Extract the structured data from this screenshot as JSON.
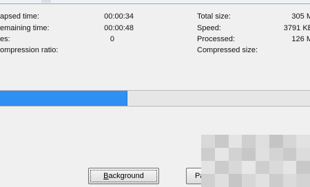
{
  "left": {
    "elapsed_label": "apsed time:",
    "elapsed_value": "00:00:34",
    "remaining_label": "emaining time:",
    "remaining_value": "00:00:48",
    "files_label": "es:",
    "files_value": "0",
    "ratio_label": "ompression ratio:",
    "ratio_value": ""
  },
  "right": {
    "total_label": "Total size:",
    "total_value": "305 M",
    "speed_label": "Speed:",
    "speed_value": "3791 KB",
    "processed_label": "Processed:",
    "processed_value": "126 M",
    "compressed_label": "Compressed size:",
    "compressed_value": ""
  },
  "progress": {
    "fraction": 0.41,
    "color": "#2f8ff2"
  },
  "buttons": {
    "background_mnemonic": "B",
    "background_rest": "ackground",
    "pause_label": "Paus"
  },
  "colors": {
    "window_bg": "#f0f0f0",
    "accent": "#2f8ff2"
  }
}
